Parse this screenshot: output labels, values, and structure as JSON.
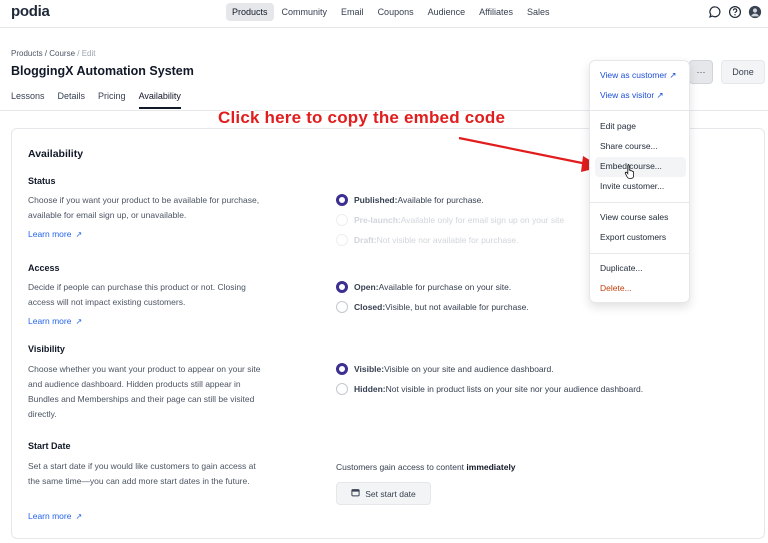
{
  "brand": {
    "logo": "podia"
  },
  "nav": {
    "items": [
      {
        "label": "Products",
        "active": true
      },
      {
        "label": "Community",
        "active": false
      },
      {
        "label": "Email",
        "active": false
      },
      {
        "label": "Coupons",
        "active": false
      },
      {
        "label": "Audience",
        "active": false
      },
      {
        "label": "Affiliates",
        "active": false
      },
      {
        "label": "Sales",
        "active": false
      }
    ],
    "icons": [
      "chat-icon",
      "help-icon",
      "avatar"
    ]
  },
  "header": {
    "breadcrumb": {
      "part1": "Products",
      "sep1": " / ",
      "part2": "Course",
      "sep2": " / ",
      "part3": "Edit"
    },
    "title": "BloggingX Automation System",
    "tabs": [
      "Lessons",
      "Details",
      "Pricing",
      "Availability"
    ],
    "active_tab": "Availability",
    "more_label": "···",
    "done_label": "Done"
  },
  "card": {
    "title": "Availability",
    "status": {
      "heading": "Status",
      "desc": "Choose if you want your product to be available for purchase, available for email sign up, or unavailable.",
      "learn": "Learn more",
      "options": [
        {
          "name": "Published:",
          "text": " Available for purchase.",
          "selected": true,
          "disabled": false
        },
        {
          "name": "Pre-launch:",
          "text": " Available only for email sign up on your site",
          "selected": false,
          "disabled": true
        },
        {
          "name": "Draft:",
          "text": " Not visible nor available for purchase.",
          "selected": false,
          "disabled": true
        }
      ]
    },
    "access": {
      "heading": "Access",
      "desc": "Decide if people can purchase this product or not. Closing access will not impact existing customers.",
      "learn": "Learn more",
      "options": [
        {
          "name": "Open:",
          "text": " Available for purchase on your site.",
          "selected": true
        },
        {
          "name": "Closed:",
          "text": " Visible, but not available for purchase.",
          "selected": false
        }
      ]
    },
    "visibility": {
      "heading": "Visibility",
      "desc": "Choose whether you want your product to appear on your site and audience dashboard. Hidden products still appear in Bundles and Memberships and their page can still be visited directly.",
      "options": [
        {
          "name": "Visible:",
          "text": " Visible on your site and audience dashboard.",
          "selected": true
        },
        {
          "name": "Hidden:",
          "text": " Not visible in product lists on your site nor your audience dashboard.",
          "selected": false
        }
      ]
    },
    "start_date": {
      "heading": "Start Date",
      "desc": "Set a start date if you would like customers to gain access at the same time—you can add more start dates in the future.",
      "learn": "Learn more",
      "gain_prefix": "Customers gain access to content ",
      "gain_value": "immediately",
      "button": "Set start date"
    }
  },
  "annotation": {
    "text": "Click here to copy the embed code",
    "color": "#e11d1d"
  },
  "menu": {
    "items": [
      {
        "label": "View as customer",
        "type": "link"
      },
      {
        "label": "View as visitor",
        "type": "link"
      },
      {
        "label": "Edit page",
        "type": "normal"
      },
      {
        "label": "Share course...",
        "type": "normal"
      },
      {
        "label": "Embed course...",
        "type": "normal",
        "hovered": true
      },
      {
        "label": "Invite customer...",
        "type": "normal"
      },
      {
        "label": "View course sales",
        "type": "normal"
      },
      {
        "label": "Export customers",
        "type": "normal"
      },
      {
        "label": "Duplicate...",
        "type": "normal"
      },
      {
        "label": "Delete...",
        "type": "danger"
      }
    ]
  },
  "colors": {
    "accent": "#3b2f91",
    "link": "#2563eb",
    "danger": "#c2410c"
  }
}
